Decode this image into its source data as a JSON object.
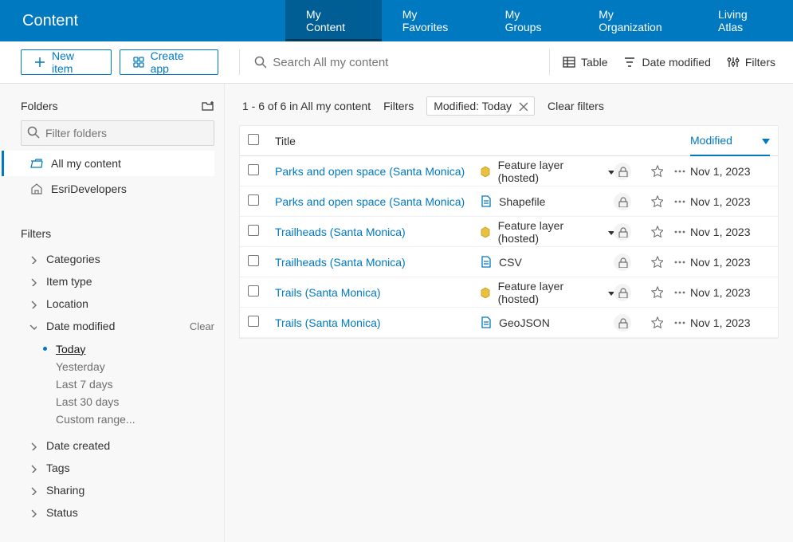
{
  "header": {
    "brand": "Content",
    "tabs": [
      "My Content",
      "My Favorites",
      "My Groups",
      "My Organization",
      "Living Atlas"
    ],
    "active_tab": 0
  },
  "toolbar": {
    "new_item": "New item",
    "create_app": "Create app",
    "search_placeholder": "Search All my content",
    "table": "Table",
    "date_modified": "Date modified",
    "filters": "Filters"
  },
  "sidebar": {
    "folders_title": "Folders",
    "filter_folders_placeholder": "Filter folders",
    "folders": [
      {
        "label": "All my content",
        "active": true,
        "icon": "folder-open"
      },
      {
        "label": "EsriDevelopers",
        "active": false,
        "icon": "home"
      }
    ],
    "filters_title": "Filters",
    "filter_groups": [
      {
        "label": "Categories",
        "expanded": false
      },
      {
        "label": "Item type",
        "expanded": false
      },
      {
        "label": "Location",
        "expanded": false
      },
      {
        "label": "Date modified",
        "expanded": true,
        "clear": "Clear",
        "options": [
          "Today",
          "Yesterday",
          "Last 7 days",
          "Last 30 days",
          "Custom range..."
        ],
        "active_option": 0
      },
      {
        "label": "Date created",
        "expanded": false
      },
      {
        "label": "Tags",
        "expanded": false
      },
      {
        "label": "Sharing",
        "expanded": false
      },
      {
        "label": "Status",
        "expanded": false
      }
    ]
  },
  "content": {
    "count_text": "1 - 6 of 6 in All my content",
    "filters_label": "Filters",
    "chip_label": "Modified: Today",
    "clear_filters": "Clear filters",
    "columns": {
      "title": "Title",
      "modified": "Modified"
    },
    "rows": [
      {
        "title": "Parks and open space (Santa Monica)",
        "type": "Feature layer (hosted)",
        "type_icon": "layer",
        "caret": true,
        "modified": "Nov 1, 2023"
      },
      {
        "title": "Parks and open space (Santa Monica)",
        "type": "Shapefile",
        "type_icon": "file",
        "caret": false,
        "modified": "Nov 1, 2023"
      },
      {
        "title": "Trailheads (Santa Monica)",
        "type": "Feature layer (hosted)",
        "type_icon": "layer",
        "caret": true,
        "modified": "Nov 1, 2023"
      },
      {
        "title": "Trailheads (Santa Monica)",
        "type": "CSV",
        "type_icon": "file",
        "caret": false,
        "modified": "Nov 1, 2023"
      },
      {
        "title": "Trails (Santa Monica)",
        "type": "Feature layer (hosted)",
        "type_icon": "layer",
        "caret": true,
        "modified": "Nov 1, 2023"
      },
      {
        "title": "Trails (Santa Monica)",
        "type": "GeoJSON",
        "type_icon": "file",
        "caret": false,
        "modified": "Nov 1, 2023"
      }
    ]
  }
}
